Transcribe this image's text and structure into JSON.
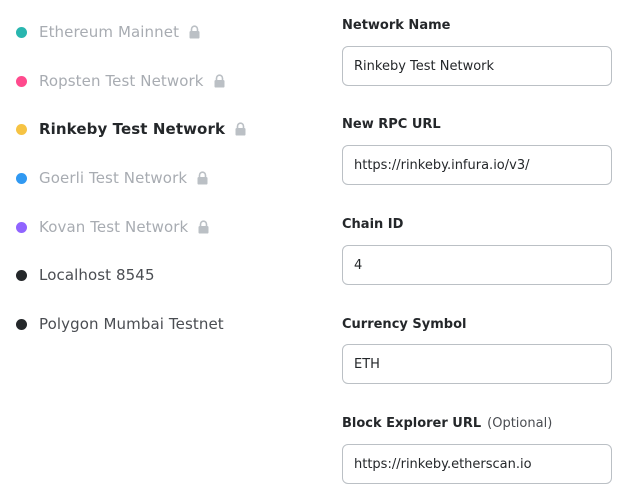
{
  "networks": [
    {
      "label": "Ethereum Mainnet",
      "color": "#29b6af",
      "state": "disabled",
      "locked": true,
      "icon": "lock-icon"
    },
    {
      "label": "Ropsten Test Network",
      "color": "#ff4a8d",
      "state": "disabled",
      "locked": true,
      "icon": "lock-icon"
    },
    {
      "label": "Rinkeby Test Network",
      "color": "#f6c343",
      "state": "selected",
      "locked": true,
      "icon": "lock-icon"
    },
    {
      "label": "Goerli Test Network",
      "color": "#3099f2",
      "state": "disabled",
      "locked": true,
      "icon": "lock-icon"
    },
    {
      "label": "Kovan Test Network",
      "color": "#9064ff",
      "state": "disabled",
      "locked": true,
      "icon": "lock-icon"
    },
    {
      "label": "Localhost 8545",
      "color": "#24272a",
      "state": "normal",
      "locked": false
    },
    {
      "label": "Polygon Mumbai Testnet",
      "color": "#24272a",
      "state": "normal",
      "locked": false
    }
  ],
  "form": {
    "network_name": {
      "label": "Network Name",
      "value": "Rinkeby Test Network"
    },
    "rpc_url": {
      "label": "New RPC URL",
      "value": "https://rinkeby.infura.io/v3/"
    },
    "chain_id": {
      "label": "Chain ID",
      "value": "4"
    },
    "currency_symbol": {
      "label": "Currency Symbol",
      "value": "ETH"
    },
    "block_explorer": {
      "label": "Block Explorer URL",
      "optional": "(Optional)",
      "value": "https://rinkeby.etherscan.io"
    }
  }
}
